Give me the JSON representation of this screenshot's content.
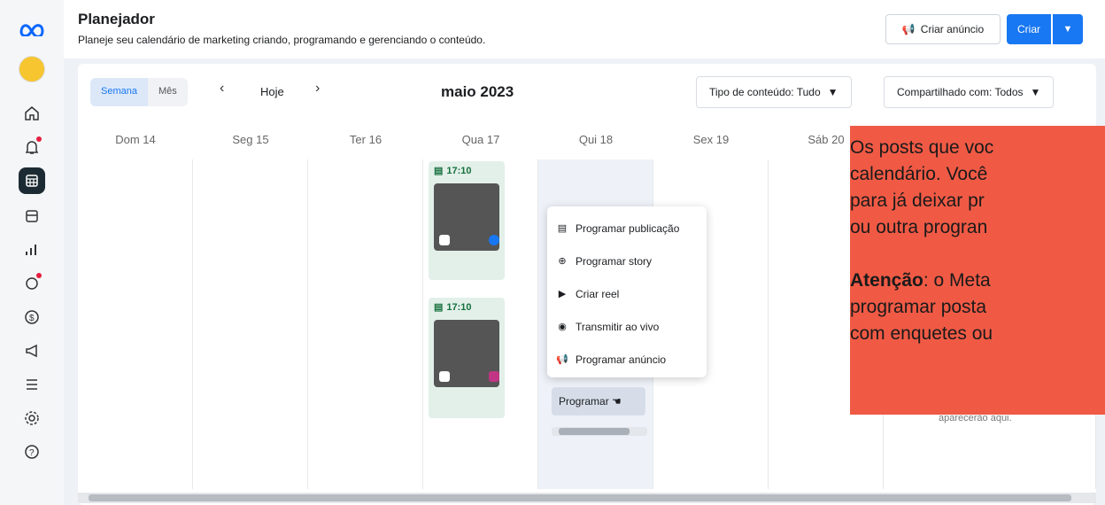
{
  "header": {
    "title": "Planejador",
    "subtitle": "Planeje seu calendário de marketing criando, programando e gerenciando o conteúdo.",
    "create_ad_label": "Criar anúncio",
    "create_label": "Criar"
  },
  "toolbar": {
    "view_week": "Semana",
    "view_month": "Mês",
    "today": "Hoje",
    "month": "maio 2023",
    "content_type": "Tipo de conteúdo: Tudo",
    "shared_with": "Compartilhado com: Todos"
  },
  "days": [
    "Dom 14",
    "Seg 15",
    "Ter 16",
    "Qua 17",
    "Qui 18",
    "Sex 19",
    "Sáb 20"
  ],
  "posts": [
    {
      "time": "17:10"
    },
    {
      "time": "17:10"
    }
  ],
  "menu": {
    "items": [
      "Programar publicação",
      "Programar story",
      "Criar reel",
      "Transmitir ao vivo",
      "Programar anúncio"
    ]
  },
  "schedule_button": "Programar",
  "empty_hint": "aparecerão aqui.",
  "callout": {
    "line1": "Os posts que voc",
    "line2": "calendário. Você",
    "line3": "para já deixar pr",
    "line4": "ou outra progran",
    "bold": "Atenção",
    "line5": ": o Meta",
    "line6": "programar posta",
    "line7": "com enquetes ou"
  },
  "colors": {
    "accent": "#1877f2",
    "callout": "#f05a45",
    "post_bg": "#e3f0ea"
  }
}
